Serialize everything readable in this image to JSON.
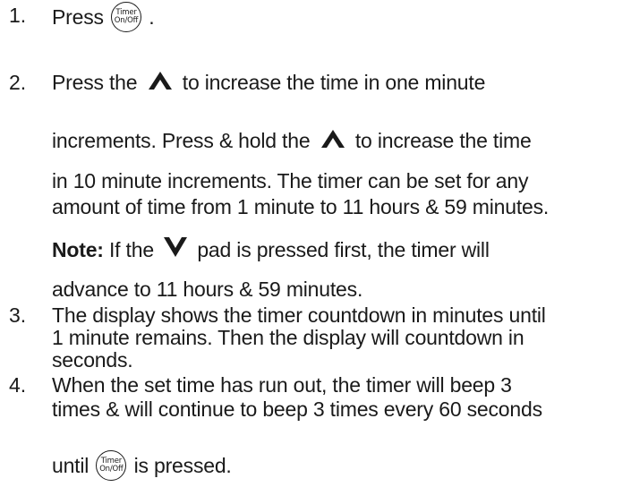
{
  "steps": [
    {
      "number": "1.",
      "lines": {
        "l1_before": "Press",
        "l1_after": " ."
      }
    },
    {
      "number": "2.",
      "lines": {
        "l1_before": "Press the",
        "l1_after": "to increase the time in one minute",
        "l2_before": "increments. Press & hold the",
        "l2_after": "to increase the time",
        "l3": "in 10 minute increments. The timer can be set for any",
        "l4": "amount of time from 1 minute to 11 hours & 59 minutes.",
        "note_label": "Note:",
        "note_before": "If the",
        "note_after": "pad is pressed first, the timer will",
        "note_l2": "advance to 11 hours & 59 minutes."
      }
    },
    {
      "number": "3.",
      "lines": {
        "l1": "The display shows the timer countdown in minutes until",
        "l2": "1 minute remains. Then the display will countdown in",
        "l3": "seconds."
      }
    },
    {
      "number": "4.",
      "lines": {
        "l1": "When the set time has run out, the timer will beep 3",
        "l2": "times & will continue to beep 3 times every 60 seconds",
        "l3_before": "until",
        "l3_after": "is pressed."
      }
    }
  ],
  "timer_button": {
    "top": "Timer",
    "bottom": "On/Off"
  },
  "icons": {
    "up": "up-arrow-icon",
    "down": "down-arrow-icon"
  }
}
